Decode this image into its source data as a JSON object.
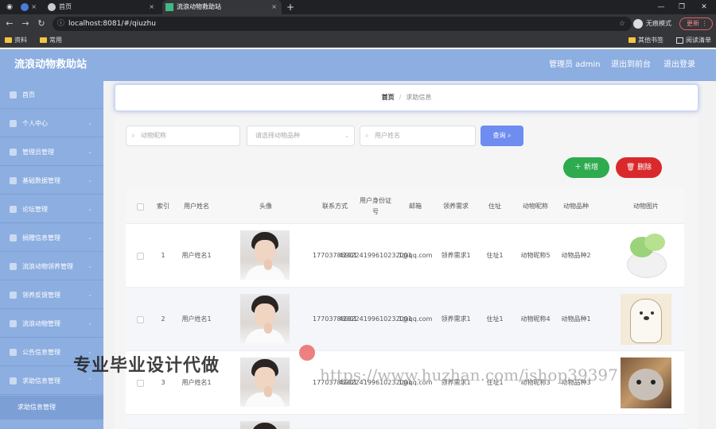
{
  "browser": {
    "tabs": [
      {
        "label": ""
      },
      {
        "label": ""
      },
      {
        "label": "首页"
      },
      {
        "label": "流浪动物救助站"
      }
    ],
    "url": "localhost:8081/#/qiuzhu",
    "profile_label": "无痕模式",
    "update_label": "更新",
    "bookmarks": [
      "资料",
      "常用"
    ],
    "bookmarks_right": [
      "其他书签",
      "阅读清单"
    ]
  },
  "app": {
    "title": "流浪动物救助站",
    "header_links": [
      "管理员 admin",
      "退出到前台",
      "退出登录"
    ]
  },
  "sidebar": {
    "items": [
      {
        "label": "首页",
        "icon": "home-icon"
      },
      {
        "label": "个人中心",
        "icon": "user-icon"
      },
      {
        "label": "管理员管理",
        "icon": "admin-icon"
      },
      {
        "label": "基础数据管理",
        "icon": "data-icon"
      },
      {
        "label": "论坛管理",
        "icon": "forum-icon"
      },
      {
        "label": "捐赠信息管理",
        "icon": "donate-icon"
      },
      {
        "label": "流浪动物领养管理",
        "icon": "adopt-icon"
      },
      {
        "label": "领养反馈管理",
        "icon": "feedback-icon"
      },
      {
        "label": "流浪动物管理",
        "icon": "animal-icon"
      },
      {
        "label": "公告信息管理",
        "icon": "notice-icon"
      },
      {
        "label": "求助信息管理",
        "icon": "help-icon"
      }
    ],
    "sub_item": "求助信息管理"
  },
  "breadcrumb": {
    "home": "首页",
    "separator": "/",
    "current": "求助信息"
  },
  "search": {
    "nickname_placeholder": "动物昵称",
    "breed_placeholder": "请选择动物品种",
    "username_placeholder": "用户姓名",
    "query_label": "查询"
  },
  "actions": {
    "add_label": "新增",
    "delete_label": "删除"
  },
  "table": {
    "headers": [
      "索引",
      "用户姓名",
      "头像",
      "联系方式",
      "用户身份证号",
      "邮箱",
      "领养需求",
      "住址",
      "动物昵称",
      "动物品种",
      "动物图片"
    ],
    "rows": [
      {
        "index": "1",
        "username": "用户姓名1",
        "phone": "17703786901",
        "idcard": "410224199610232001",
        "email": "1@qq.com",
        "demand": "领养需求1",
        "address": "住址1",
        "nickname": "动物昵称5",
        "breed": "动物品种2",
        "animal_img": "bok-choy-cat-image"
      },
      {
        "index": "2",
        "username": "用户姓名1",
        "phone": "17703786901",
        "idcard": "410224199610232001",
        "email": "1@qq.com",
        "demand": "领养需求1",
        "address": "住址1",
        "nickname": "动物昵称4",
        "breed": "动物品种1",
        "animal_img": "cartoon-bear-image"
      },
      {
        "index": "3",
        "username": "用户姓名1",
        "phone": "17703786901",
        "idcard": "410224199610232001",
        "email": "1@qq.com",
        "demand": "领养需求1",
        "address": "住址1",
        "nickname": "动物昵称3",
        "breed": "动物品种3",
        "animal_img": "cat-photo-image"
      }
    ]
  },
  "watermarks": {
    "left": "专业毕业设计代做",
    "right": "https://www.huzhan.com/ishop39397"
  },
  "colors": {
    "theme": "#8caee0",
    "query": "#6f8df0",
    "add": "#2eaa4f",
    "delete": "#d9292b"
  }
}
